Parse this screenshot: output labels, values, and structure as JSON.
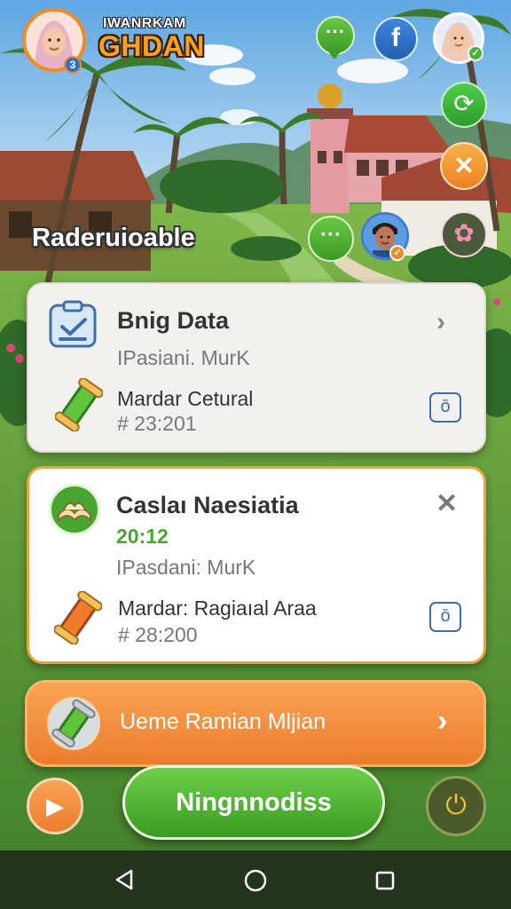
{
  "header": {
    "title_top": "IWANRKAM",
    "title_main": "GHDAN",
    "level_badge": "3"
  },
  "section_title": "Raderuioable",
  "cards": [
    {
      "title": "Bnig Data",
      "subtitle": "IPasiani. MurK",
      "item_label": "Mardar Cetural",
      "item_code": "# 23:201",
      "icon": "clipboard-icon",
      "item_icon": "scroll-icon"
    },
    {
      "title": "Caslaı Naesiatia",
      "time": "20:12",
      "subtitle": "IPasdani: MurK",
      "item_label": "Mardar: Ragiaıal Araa",
      "item_code": "# 28:200",
      "icon": "book-icon",
      "item_icon": "scroll-icon"
    }
  ],
  "banner": {
    "label": "Ueme Ramian Mljian"
  },
  "main_button": {
    "label": "Ningnnodiss"
  },
  "colors": {
    "accent_orange": "#f08a24",
    "accent_green": "#4ea52d",
    "card_bg": "#f2f1ee",
    "facebook_blue": "#2a6fc9"
  },
  "icons": [
    "chat-icon",
    "facebook-icon",
    "refresh-icon",
    "close-icon",
    "flower-icon",
    "play-icon",
    "power-icon",
    "back-icon",
    "home-icon",
    "recents-icon"
  ]
}
